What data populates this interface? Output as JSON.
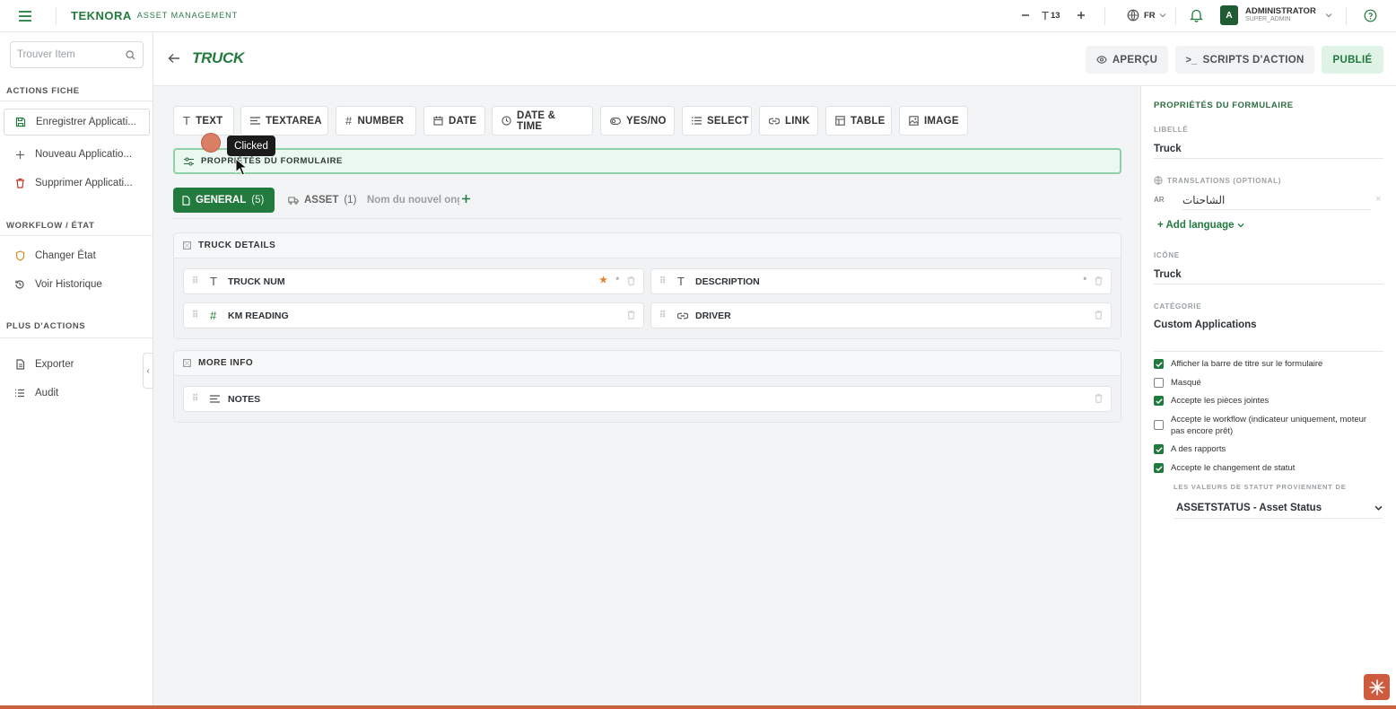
{
  "topbar": {
    "brand": "TEKNORA",
    "brand_sub": "ASSET MANAGEMENT",
    "font_size_value": "13",
    "language": "FR",
    "user_initial": "A",
    "user_name": "ADMINISTRATOR",
    "user_role": "SUPER_ADMIN"
  },
  "sidebar": {
    "search_placeholder": "Trouver Item",
    "sections": {
      "actions_fiche": "ACTIONS FICHE",
      "workflow": "WORKFLOW / ÉTAT",
      "plus_actions": "PLUS D'ACTIONS"
    },
    "items": {
      "save": "Enregistrer Applicati...",
      "new": "Nouveau Applicatio...",
      "delete": "Supprimer Applicati...",
      "change_state": "Changer État",
      "history": "Voir Historique",
      "export": "Exporter",
      "audit": "Audit"
    }
  },
  "header": {
    "title": "TRUCK",
    "preview_label": "APERÇU",
    "scripts_label": "SCRIPTS D'ACTION",
    "publish_label": "PUBLIÉ"
  },
  "field_types": [
    "TEXT",
    "TEXTAREA",
    "NUMBER",
    "DATE",
    "DATE & TIME",
    "YES/NO",
    "SELECT",
    "LINK",
    "TABLE",
    "IMAGE"
  ],
  "form_props_bar": "PROPRIÉTÉS DU FORMULAIRE",
  "tabs": {
    "general": "GENERAL",
    "general_count": "(5)",
    "asset": "ASSET",
    "asset_count": "(1)",
    "new_placeholder": "Nom du nouvel onglet"
  },
  "sections": {
    "truck_details": "TRUCK DETAILS",
    "more_info": "MORE INFO"
  },
  "fields": {
    "truck_num": "TRUCK NUM",
    "description": "DESCRIPTION",
    "km_reading": "KM READING",
    "driver": "DRIVER",
    "notes": "NOTES"
  },
  "right_panel": {
    "title": "PROPRIÉTÉS DU FORMULAIRE",
    "label_caption": "LIBELLÉ",
    "label_value": "Truck",
    "translations_caption": "TRANSLATIONS (OPTIONAL)",
    "translation_lang": "AR",
    "translation_value": "الشاحنات",
    "add_language": "+ Add language",
    "icon_caption": "ICÔNE",
    "icon_value": "Truck",
    "category_caption": "CATÉGORIE",
    "category_value": "Custom Applications",
    "checkboxes": [
      {
        "label": "Afficher la barre de titre sur le formulaire",
        "checked": true
      },
      {
        "label": "Masqué",
        "checked": false
      },
      {
        "label": "Accepte les pièces jointes",
        "checked": true
      },
      {
        "label": "Accepte le workflow (indicateur uniquement, moteur pas encore prêt)",
        "checked": false
      },
      {
        "label": "A des rapports",
        "checked": true
      },
      {
        "label": "Accepte le changement de statut",
        "checked": true
      }
    ],
    "status_source_caption": "LES VALEURS DE STATUT PROVIENNENT DE",
    "status_source_value": "ASSETSTATUS - Asset Status"
  },
  "overlay": {
    "tooltip": "Clicked"
  },
  "colors": {
    "brand_green": "#237a3e",
    "publish_bg": "#dff3e6",
    "active_outline": "#8fd0a6",
    "accent_orange": "#cf5b3f"
  }
}
